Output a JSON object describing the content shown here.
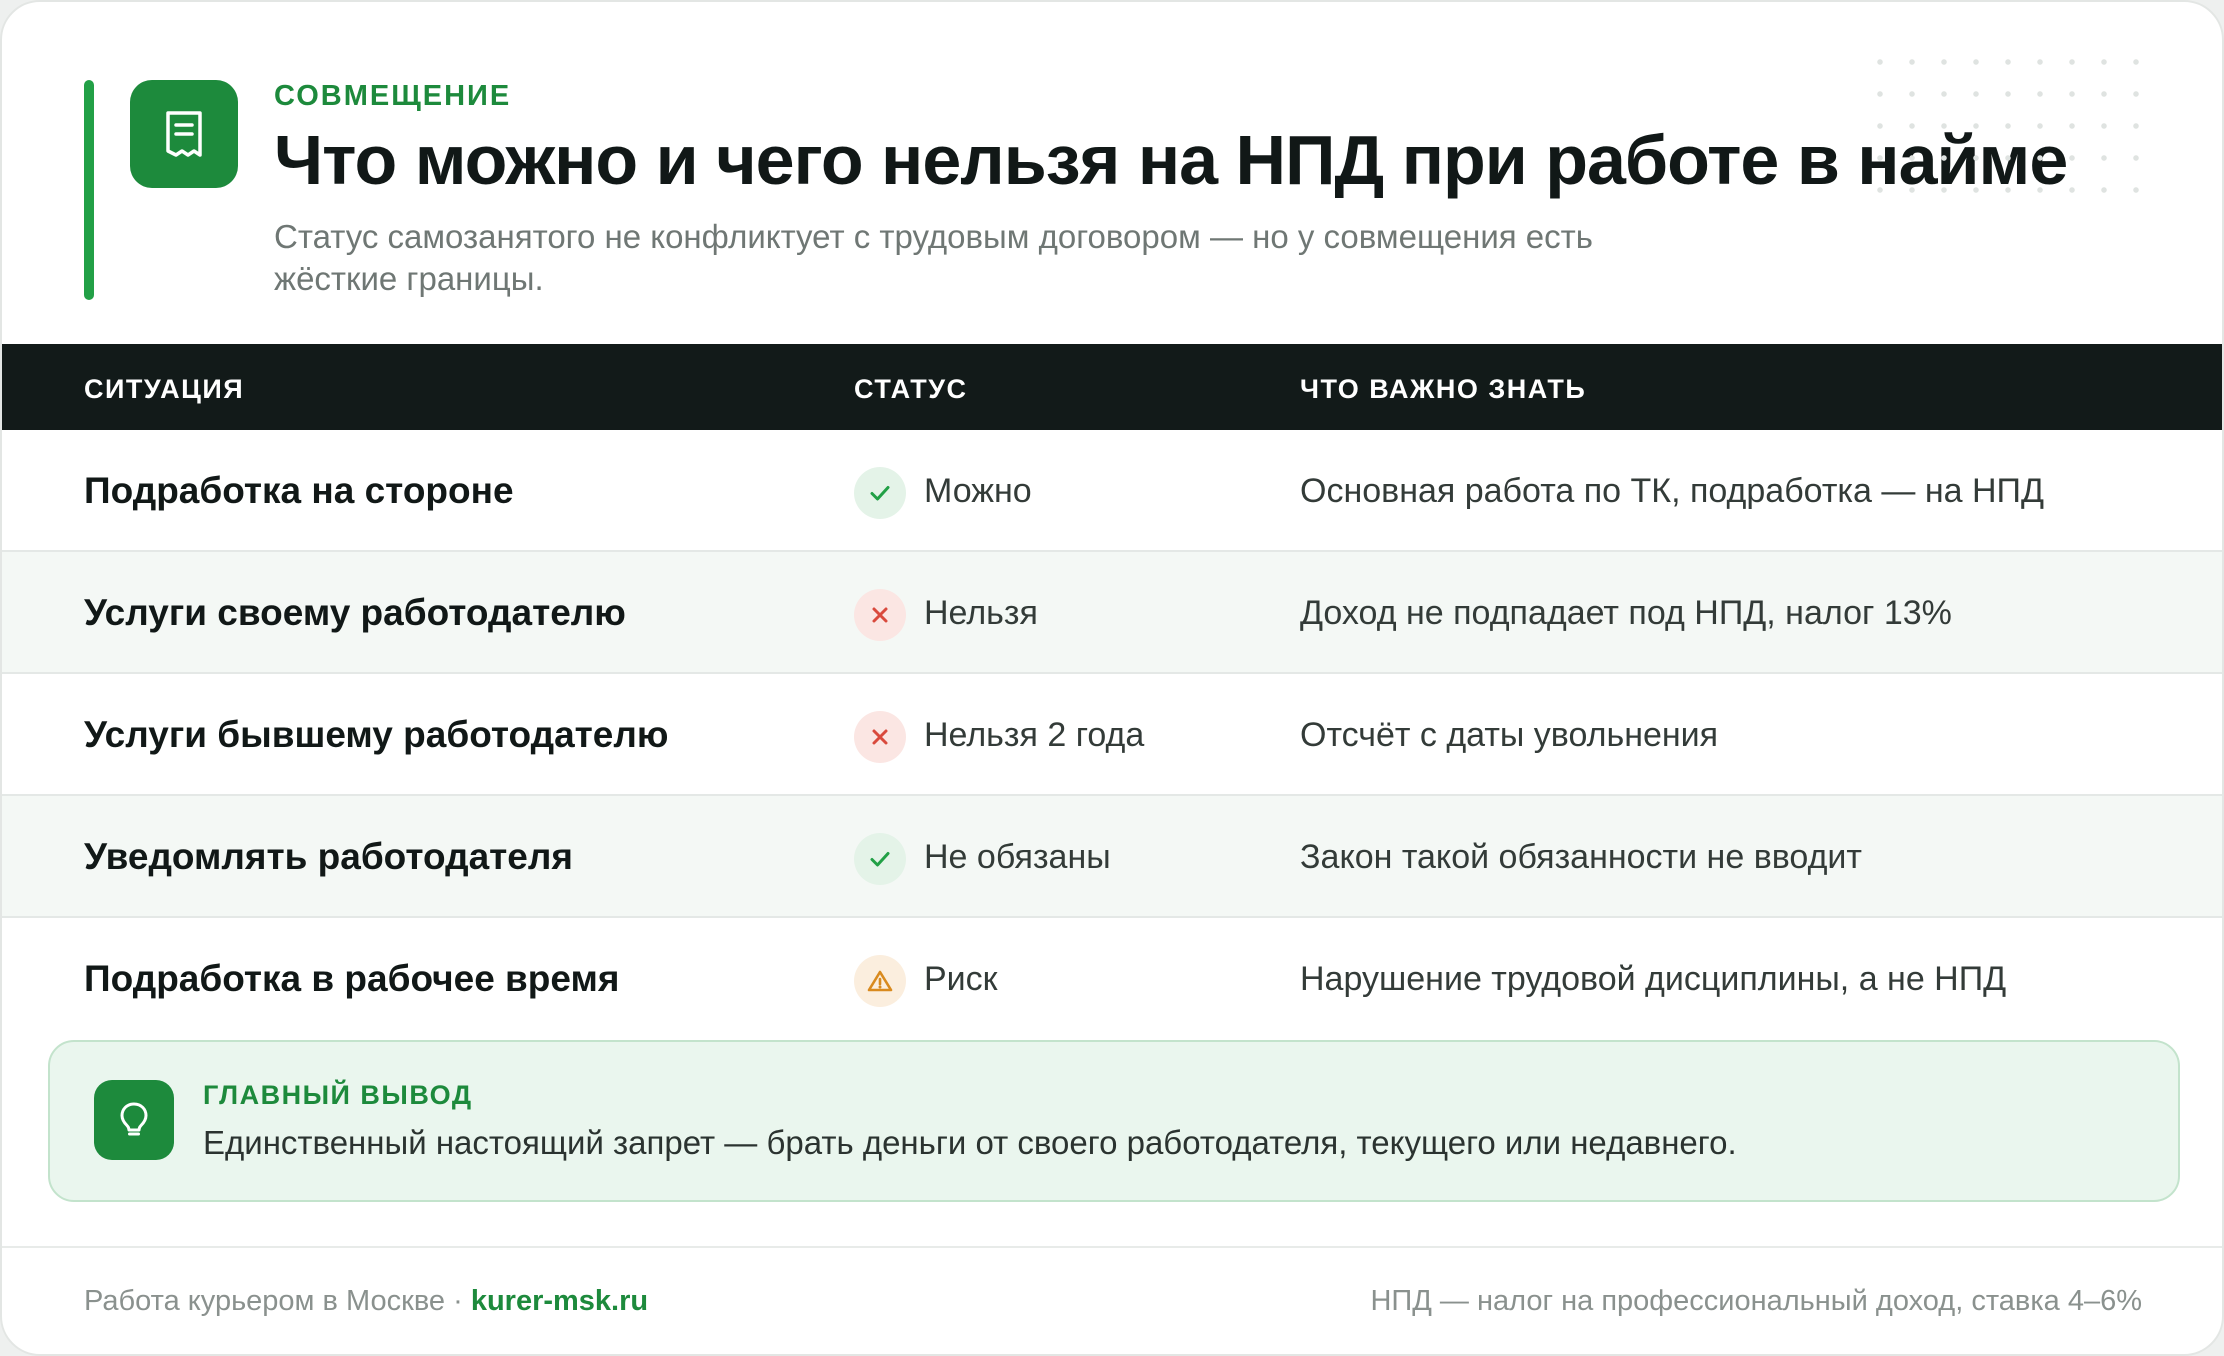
{
  "header": {
    "eyebrow": "СОВМЕЩЕНИЕ",
    "title": "Что можно и чего нельзя на НПД при работе в найме",
    "subtitle": "Статус самозанятого не конфликтует с трудовым договором — но у совмещения есть жёсткие границы.",
    "icon": "receipt-icon"
  },
  "table": {
    "headers": [
      "СИТУАЦИЯ",
      "СТАТУС",
      "ЧТО ВАЖНО ЗНАТЬ"
    ],
    "rows": [
      {
        "situation": "Подработка на стороне",
        "status": "Можно",
        "status_icon": "check-icon",
        "note": "Основная работа по ТК, подработка — на НПД"
      },
      {
        "situation": "Услуги своему работодателю",
        "status": "Нельзя",
        "status_icon": "cross-icon",
        "note": "Доход не подпадает под НПД, налог 13%"
      },
      {
        "situation": "Услуги бывшему работодателю",
        "status": "Нельзя 2 года",
        "status_icon": "cross-icon",
        "note": "Отсчёт с даты увольнения"
      },
      {
        "situation": "Уведомлять работодателя",
        "status": "Не обязаны",
        "status_icon": "check-icon",
        "note": "Закон такой обязанности не вводит"
      },
      {
        "situation": "Подработка в рабочее время",
        "status": "Риск",
        "status_icon": "warning-icon",
        "note": "Нарушение трудовой дисциплины, а не НПД"
      }
    ]
  },
  "conclusion": {
    "label": "ГЛАВНЫЙ ВЫВОД",
    "text": "Единственный настоящий запрет — брать деньги от своего работодателя, текущего или недавнего.",
    "icon": "lightbulb-icon"
  },
  "footer": {
    "left_text": "Работа курьером в Москве · ",
    "site": "kurer-msk.ru",
    "right_text": "НПД — налог на профессиональный доход, ставка 4–6%"
  },
  "colors": {
    "accent": "#1d8a3c",
    "header_bg": "#121a19",
    "ok": "#22a046",
    "no": "#d94a3d",
    "risk": "#d98a1e"
  }
}
